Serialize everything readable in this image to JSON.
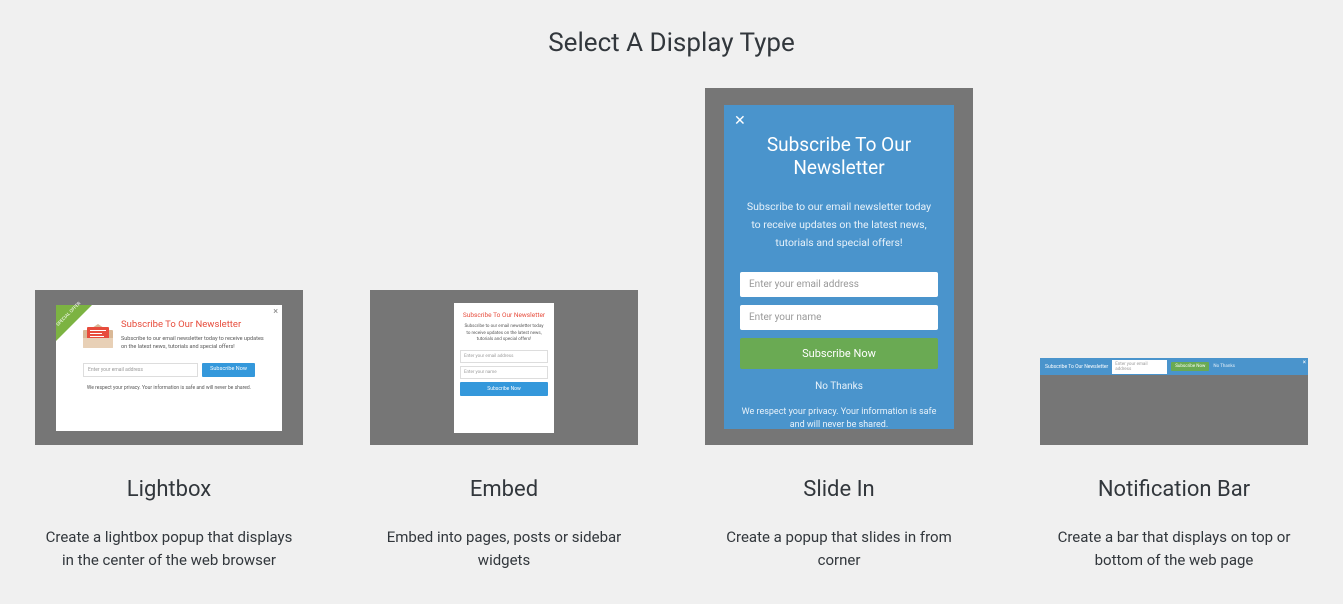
{
  "page_title": "Select A Display Type",
  "options": [
    {
      "title": "Lightbox",
      "description": "Create a lightbox popup that displays in the center of the web browser",
      "preview": {
        "ribbon_text": "SPECIAL OFFER",
        "title": "Subscribe To Our Newsletter",
        "subtitle": "Subscribe to our email newsletter today to receive updates on the latest news, tutorials and special offers!",
        "email_placeholder": "Enter your email address",
        "button": "Subscribe Now",
        "privacy": "We respect your privacy. Your information is safe and will never be shared."
      }
    },
    {
      "title": "Embed",
      "description": "Embed into pages, posts or sidebar widgets",
      "preview": {
        "title": "Subscribe To Our Newsletter",
        "subtitle": "Subscribe to our email newsletter today to receive updates on the latest news, tutorials and special offers!",
        "email_placeholder": "Enter your email address",
        "name_placeholder": "Enter your name",
        "button": "Subscribe Now"
      }
    },
    {
      "title": "Slide In",
      "description": "Create a popup that slides in from corner",
      "preview": {
        "title": "Subscribe To Our Newsletter",
        "subtitle": "Subscribe to our email newsletter today to receive updates on the latest news, tutorials and special offers!",
        "email_placeholder": "Enter your email address",
        "name_placeholder": "Enter your name",
        "button": "Subscribe Now",
        "no_thanks": "No Thanks",
        "privacy": "We respect your privacy. Your information is safe and will never be shared."
      }
    },
    {
      "title": "Notification Bar",
      "description": "Create a bar that displays on top or bottom of the web page",
      "preview": {
        "title": "Subscribe To Our Newsletter",
        "email_placeholder": "Enter your email address",
        "button": "Subscribe Now",
        "no_thanks": "No Thanks"
      }
    }
  ]
}
